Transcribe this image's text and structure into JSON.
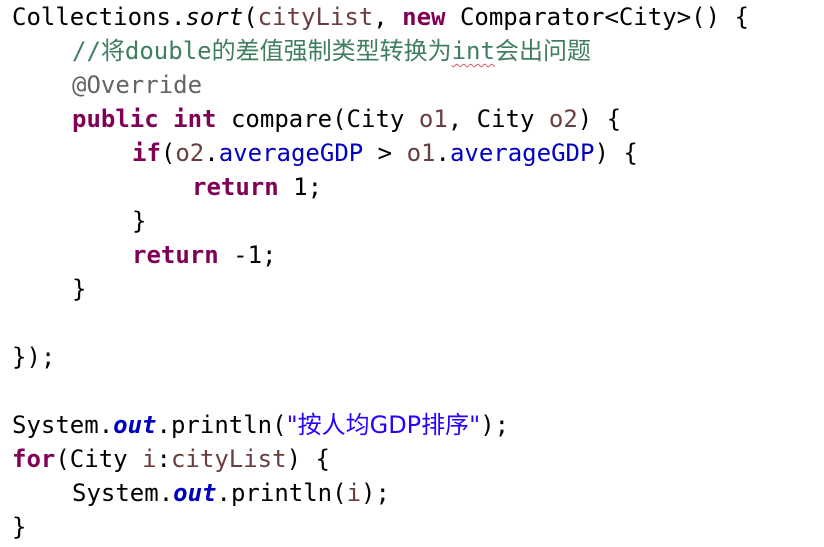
{
  "editor": {
    "line1": {
      "a": "Collections.",
      "b": "sort",
      "c": "(",
      "d": "cityList",
      "e": ", ",
      "f": "new",
      "g": " Comparator<City>() {"
    },
    "line2": {
      "comment_a": "//将",
      "comment_b": "double",
      "comment_c": "的差值强制类型转换为",
      "comment_d": "int",
      "comment_e": "会出问题"
    },
    "line3": {
      "annotation": "@Override"
    },
    "line4": {
      "kw1": "public",
      "sp1": " ",
      "kw2": "int",
      "rest1": " compare(City ",
      "p1": "o1",
      "rest2": ", City ",
      "p2": "o2",
      "rest3": ") {"
    },
    "line5": {
      "kw": "if",
      "a": "(",
      "p2": "o2",
      "dot1": ".",
      "field1": "averageGDP",
      "op": " > ",
      "p1": "o1",
      "dot2": ".",
      "field2": "averageGDP",
      "end": ") {"
    },
    "line6": {
      "kw": "return",
      "rest": " 1;"
    },
    "line7": {
      "text": "}"
    },
    "line8": {
      "kw": "return",
      "rest": " -1;"
    },
    "line9": {
      "text": "}"
    },
    "line11": {
      "text": "});"
    },
    "line13": {
      "a": "System.",
      "field": "out",
      "b": ".println(",
      "str": "\"按人均GDP排序\"",
      "c": ");"
    },
    "line14": {
      "kw": "for",
      "a": "(City ",
      "param": "i",
      "b": ":",
      "var": "cityList",
      "c": ") {"
    },
    "line15": {
      "a": "System.",
      "field": "out",
      "b": ".println(",
      "param": "i",
      "c": ");"
    },
    "line16": {
      "text": "}"
    }
  }
}
